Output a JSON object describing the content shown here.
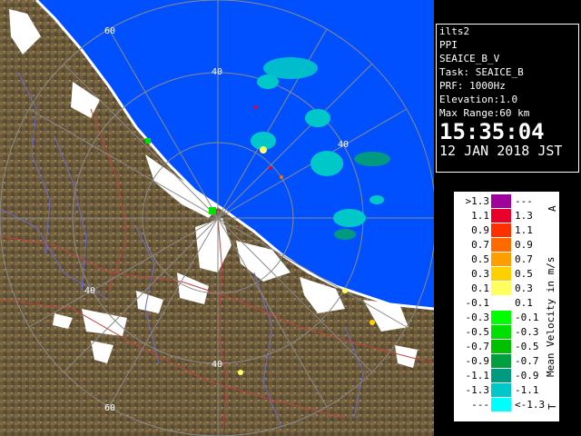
{
  "info": {
    "site": "ilts2",
    "mode": "PPI",
    "product": "SEAICE_B_V",
    "task": "Task: SEAICE_B",
    "prf": "PRF: 1000Hz",
    "elevation": "Elevation:1.0",
    "max_range": "Max Range:60 km",
    "time": "15:35:04",
    "date": "12 JAN 2018 JST"
  },
  "legend": {
    "title": "Mean Velocity in m/s",
    "top_marker": "A",
    "bottom_marker": "T",
    "rows": [
      {
        "lo": ">1.3",
        "hi": "---",
        "color": "#a0009c"
      },
      {
        "lo": "1.1",
        "hi": "1.3",
        "color": "#e8002a"
      },
      {
        "lo": "0.9",
        "hi": "1.1",
        "color": "#ff3000"
      },
      {
        "lo": "0.7",
        "hi": "0.9",
        "color": "#ff6a00"
      },
      {
        "lo": "0.5",
        "hi": "0.7",
        "color": "#ff9e00"
      },
      {
        "lo": "0.3",
        "hi": "0.5",
        "color": "#ffd000"
      },
      {
        "lo": "0.1",
        "hi": "0.3",
        "color": "#ffff60"
      },
      {
        "lo": "-0.1",
        "hi": "0.1",
        "color": "#ffffff"
      },
      {
        "lo": "-0.3",
        "hi": "-0.1",
        "color": "#00ff00"
      },
      {
        "lo": "-0.5",
        "hi": "-0.3",
        "color": "#00e000"
      },
      {
        "lo": "-0.7",
        "hi": "-0.5",
        "color": "#00c000"
      },
      {
        "lo": "-0.9",
        "hi": "-0.7",
        "color": "#00a040"
      },
      {
        "lo": "-1.1",
        "hi": "-0.9",
        "color": "#009a80"
      },
      {
        "lo": "-1.3",
        "hi": "-1.1",
        "color": "#00c8c8"
      },
      {
        "lo": "---",
        "hi": "<-1.3",
        "color": "#00ffff"
      }
    ]
  },
  "map": {
    "range_ring_labels": [
      "60",
      "40",
      "40",
      "40",
      "40",
      "60"
    ],
    "colors": {
      "sea": "#0050ff",
      "land": "#6b5a3a",
      "snow": "#ffffff",
      "rings": "#8a8a8a"
    }
  }
}
